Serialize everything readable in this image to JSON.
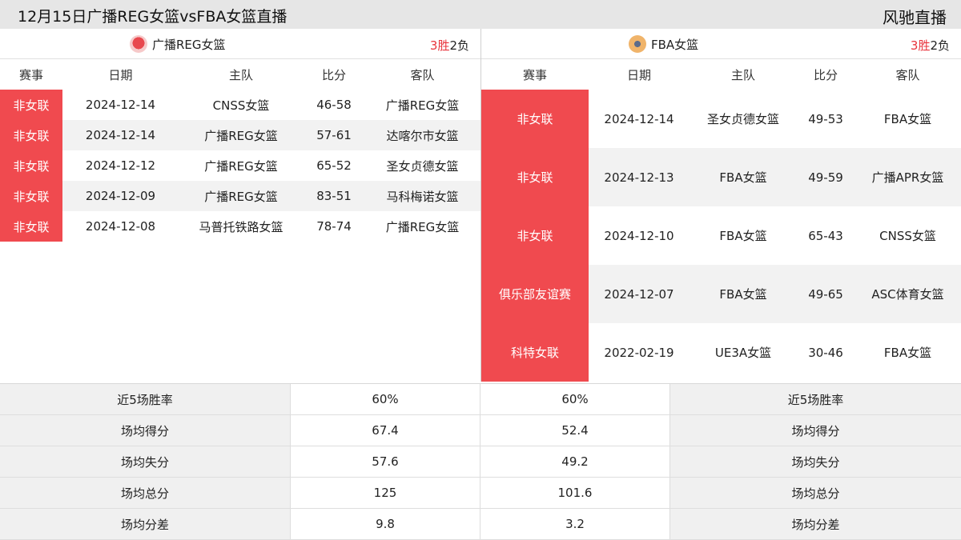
{
  "header": {
    "title": "12月15日广播REG女篮vsFBA女篮直播",
    "brand": "风驰直播"
  },
  "columns": [
    "赛事",
    "日期",
    "主队",
    "比分",
    "客队"
  ],
  "left": {
    "team": "广播REG女篮",
    "logo_icon": "team-logo-reg",
    "logo_color": "#e8484e",
    "record_wins": "3胜",
    "record_losses": "2负",
    "matches": [
      {
        "competition": "非女联",
        "date": "2024-12-14",
        "home": "CNSS女篮",
        "score": "46-58",
        "away": "广播REG女篮"
      },
      {
        "competition": "非女联",
        "date": "2024-12-14",
        "home": "广播REG女篮",
        "score": "57-61",
        "away": "达喀尔市女篮"
      },
      {
        "competition": "非女联",
        "date": "2024-12-12",
        "home": "广播REG女篮",
        "score": "65-52",
        "away": "圣女贞德女篮"
      },
      {
        "competition": "非女联",
        "date": "2024-12-09",
        "home": "广播REG女篮",
        "score": "83-51",
        "away": "马科梅诺女篮"
      },
      {
        "competition": "非女联",
        "date": "2024-12-08",
        "home": "马普托铁路女篮",
        "score": "78-74",
        "away": "广播REG女篮"
      }
    ]
  },
  "right": {
    "team": "FBA女篮",
    "logo_icon": "team-logo-fba",
    "logo_color": "#f0b46a",
    "record_wins": "3胜",
    "record_losses": "2负",
    "matches": [
      {
        "competition": "非女联",
        "date": "2024-12-14",
        "home": "圣女贞德女篮",
        "score": "49-53",
        "away": "FBA女篮"
      },
      {
        "competition": "非女联",
        "date": "2024-12-13",
        "home": "FBA女篮",
        "score": "49-59",
        "away": "广播APR女篮"
      },
      {
        "competition": "非女联",
        "date": "2024-12-10",
        "home": "FBA女篮",
        "score": "65-43",
        "away": "CNSS女篮"
      },
      {
        "competition": "俱乐部友谊赛",
        "date": "2024-12-07",
        "home": "FBA女篮",
        "score": "49-65",
        "away": "ASC体育女篮"
      },
      {
        "competition": "科特女联",
        "date": "2022-02-19",
        "home": "UE3A女篮",
        "score": "30-46",
        "away": "FBA女篮"
      }
    ]
  },
  "stats": [
    {
      "label": "近5场胜率",
      "left": "60%",
      "right": "60%"
    },
    {
      "label": "场均得分",
      "left": "67.4",
      "right": "52.4"
    },
    {
      "label": "场均失分",
      "left": "57.6",
      "right": "49.2"
    },
    {
      "label": "场均总分",
      "left": "125",
      "right": "101.6"
    },
    {
      "label": "场均分差",
      "left": "9.8",
      "right": "3.2"
    }
  ],
  "colors": {
    "accent_red": "#f04a4f",
    "win_red": "#e8353d"
  }
}
